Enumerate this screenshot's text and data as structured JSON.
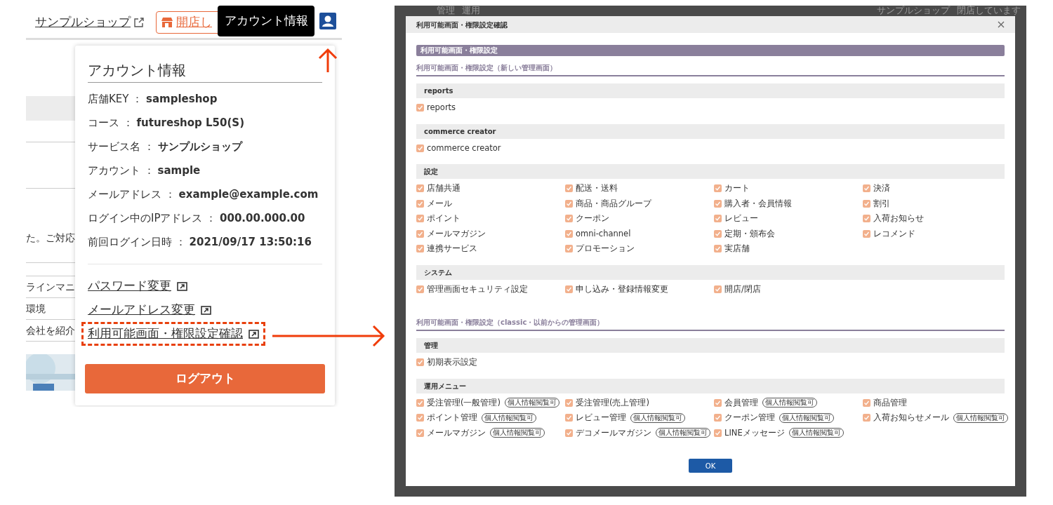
{
  "account_menu": {
    "shop_link": "サンプルショップ",
    "store_button": "開店し",
    "tooltip": "アカウント情報",
    "background_texts": [
      "た。ご対応",
      "ラインマニ",
      "環境",
      "会社を紹介"
    ],
    "title": "アカウント情報",
    "fields": [
      "店舗KEY ： **sampleshop**",
      "コース ： **futureshop L50(S)**",
      "サービス名 ： **サンプルショップ**",
      "アカウント ： **sample**",
      "メールアドレス ： **example@example.com**",
      "ログイン中のIPアドレス ： **000.00.000.00**",
      "前回ログイン日時 ： **2021/09/17 13:50:16**"
    ],
    "links": [
      {
        "label": "パスワード変更",
        "highlighted": false
      },
      {
        "label": "メールアドレス変更",
        "highlighted": false
      },
      {
        "label": "利用可能画面・権限設定確認",
        "highlighted": true
      }
    ],
    "logout_button": "ログアウト"
  },
  "dialog": {
    "background_texts": [
      "管理",
      "運用",
      "サンプルショップ",
      "閉店しています"
    ],
    "title": "利用可能画面・権限設定確認",
    "section_title": "利用可能画面・権限設定",
    "subsections": [
      {
        "title": "利用可能画面・権限設定（新しい管理画面）",
        "groups": [
          {
            "title": "reports",
            "items": [
              {
                "label": "reports",
                "checked": true
              }
            ]
          },
          {
            "title": "commerce creator",
            "items": [
              {
                "label": "commerce creator",
                "checked": true
              }
            ]
          },
          {
            "title": "設定",
            "items": [
              {
                "label": "店舗共通",
                "checked": true
              },
              {
                "label": "配送・送料",
                "checked": true
              },
              {
                "label": "カート",
                "checked": true
              },
              {
                "label": "決済",
                "checked": true
              },
              {
                "label": "メール",
                "checked": true
              },
              {
                "label": "商品・商品グループ",
                "checked": true
              },
              {
                "label": "購入者・会員情報",
                "checked": true
              },
              {
                "label": "割引",
                "checked": true
              },
              {
                "label": "ポイント",
                "checked": true
              },
              {
                "label": "クーポン",
                "checked": true
              },
              {
                "label": "レビュー",
                "checked": true
              },
              {
                "label": "入荷お知らせ",
                "checked": true
              },
              {
                "label": "メールマガジン",
                "checked": true
              },
              {
                "label": "omni-channel",
                "checked": true
              },
              {
                "label": "定期・頒布会",
                "checked": true
              },
              {
                "label": "レコメンド",
                "checked": true
              },
              {
                "label": "連携サービス",
                "checked": true
              },
              {
                "label": "プロモーション",
                "checked": true
              },
              {
                "label": "実店舗",
                "checked": true
              }
            ]
          },
          {
            "title": "システム",
            "items": [
              {
                "label": "管理画面セキュリティ設定",
                "checked": true
              },
              {
                "label": "申し込み・登録情報変更",
                "checked": true
              },
              {
                "label": "開店/閉店",
                "checked": true
              }
            ]
          }
        ]
      },
      {
        "title": "利用可能画面・権限設定（classic・以前からの管理画面）",
        "groups": [
          {
            "title": "管理",
            "items": [
              {
                "label": "初期表示設定",
                "checked": true
              }
            ]
          },
          {
            "title": "運用メニュー",
            "items": [
              {
                "label": "受注管理(一般管理)",
                "checked": true,
                "badge": "個人情報閲覧可"
              },
              {
                "label": "受注管理(売上管理)",
                "checked": true
              },
              {
                "label": "会員管理",
                "checked": true,
                "badge": "個人情報閲覧可"
              },
              {
                "label": "商品管理",
                "checked": true
              },
              {
                "label": "ポイント管理",
                "checked": true,
                "badge": "個人情報閲覧可"
              },
              {
                "label": "レビュー管理",
                "checked": true,
                "badge": "個人情報閲覧可"
              },
              {
                "label": "クーポン管理",
                "checked": true,
                "badge": "個人情報閲覧可"
              },
              {
                "label": "入荷お知らせメール",
                "checked": true,
                "badge": "個人情報閲覧可"
              },
              {
                "label": "メールマガジン",
                "checked": true,
                "badge": "個人情報閲覧可"
              },
              {
                "label": "デコメールマガジン",
                "checked": true,
                "badge": "個人情報閲覧可"
              },
              {
                "label": "LINEメッセージ",
                "checked": true,
                "badge": "個人情報閲覧可"
              }
            ]
          }
        ]
      }
    ],
    "ok_button": "OK"
  }
}
